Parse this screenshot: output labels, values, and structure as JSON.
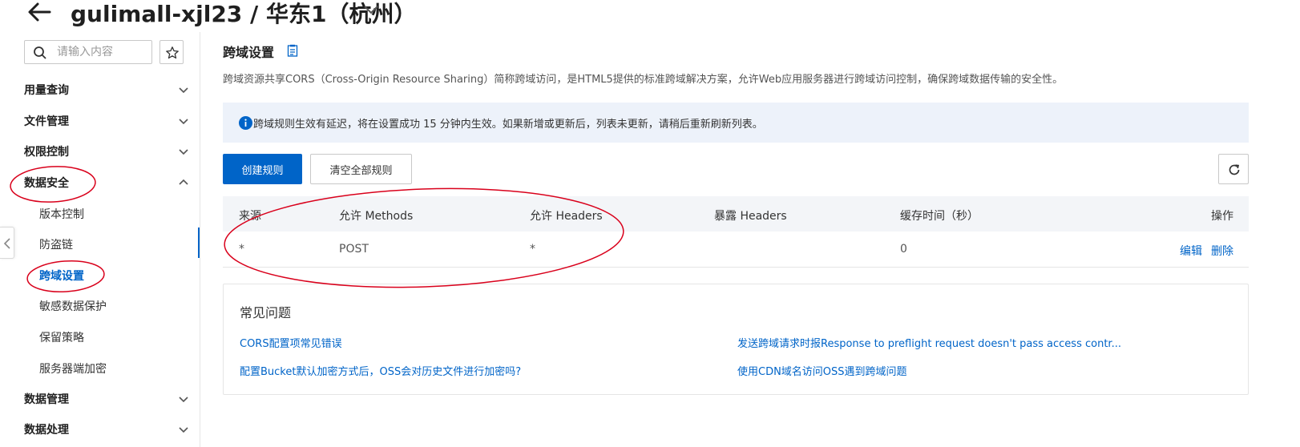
{
  "header": {
    "title": "gulimall-xjl23 / 华东1（杭州）"
  },
  "sidebar": {
    "search_placeholder": "请输入内容",
    "groups": [
      {
        "label": "用量查询"
      },
      {
        "label": "文件管理"
      },
      {
        "label": "权限控制"
      },
      {
        "label": "数据安全"
      },
      {
        "label": "数据管理"
      },
      {
        "label": "数据处理"
      }
    ],
    "sub_items": [
      {
        "label": "版本控制"
      },
      {
        "label": "防盗链"
      },
      {
        "label": "跨域设置"
      },
      {
        "label": "敏感数据保护"
      },
      {
        "label": "保留策略"
      },
      {
        "label": "服务器端加密"
      }
    ]
  },
  "main": {
    "title": "跨域设置",
    "description": "跨域资源共享CORS（Cross-Origin Resource Sharing）简称跨域访问，是HTML5提供的标准跨域解决方案，允许Web应用服务器进行跨域访问控制，确保跨域数据传输的安全性。",
    "notice": "跨域规则生效有延迟，将在设置成功 15 分钟内生效。如果新增或更新后，列表未更新，请稍后重新刷新列表。",
    "create_button": "创建规则",
    "clear_button": "清空全部规则",
    "table": {
      "headers": [
        "来源",
        "允许 Methods",
        "允许 Headers",
        "暴露 Headers",
        "缓存时间（秒）",
        "操作"
      ],
      "rows": [
        {
          "source": "*",
          "methods": "POST",
          "headers": "*",
          "expose": "",
          "max_age": "0",
          "edit": "编辑",
          "delete": "删除"
        }
      ]
    },
    "faq": {
      "title": "常见问题",
      "links": [
        "CORS配置项常见错误",
        "发送跨域请求时报Response to preflight request doesn't pass access contr...",
        "配置Bucket默认加密方式后，OSS会对历史文件进行加密吗?",
        "使用CDN域名访问OSS遇到跨域问题"
      ]
    }
  },
  "colors": {
    "accent": "#0064c8",
    "annotation": "#d9001b",
    "notice_bg": "#edf2fa",
    "table_header_bg": "#f3f5f8"
  }
}
